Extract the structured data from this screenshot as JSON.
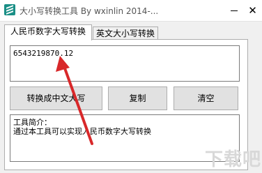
{
  "window": {
    "title": "大小写转换工具  By  wxinlin    2014-...",
    "close_label": "✕"
  },
  "tabs": [
    {
      "label": "人民币数字大写转换",
      "active": true
    },
    {
      "label": "英文大小写转换",
      "active": false
    }
  ],
  "main": {
    "amount_value": "6543219870.12",
    "buttons": {
      "convert_label": "转换成中文大写",
      "copy_label": "复制",
      "clear_label": "清空"
    },
    "info": {
      "line1": "工具简介：",
      "line2": "通过本工具可以实现人民币数字大写转换"
    }
  },
  "watermark": "下载吧",
  "colors": {
    "annotation_arrow": "#d8282a",
    "icon": "#1a8f86"
  }
}
